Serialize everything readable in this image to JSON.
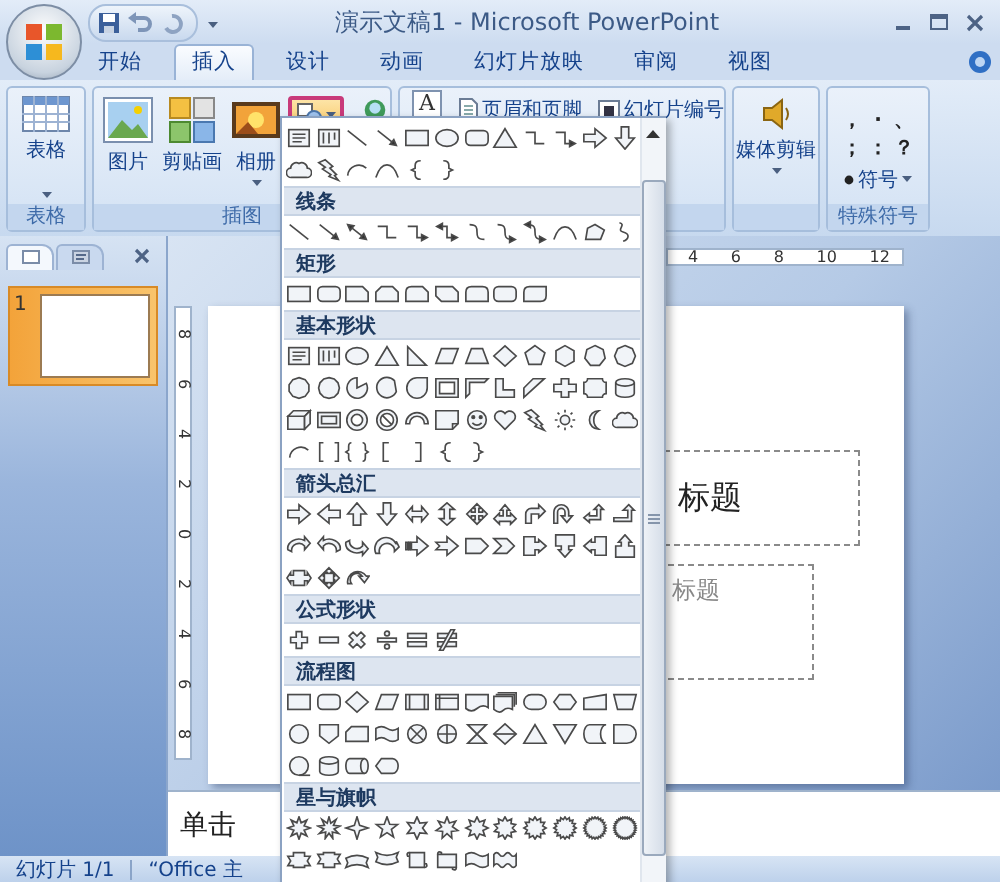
{
  "window": {
    "title": "演示文稿1 - Microsoft PowerPoint"
  },
  "tabs": [
    {
      "label": "开始",
      "selected": false
    },
    {
      "label": "插入",
      "selected": true
    },
    {
      "label": "设计",
      "selected": false
    },
    {
      "label": "动画",
      "selected": false
    },
    {
      "label": "幻灯片放映",
      "selected": false
    },
    {
      "label": "审阅",
      "selected": false
    },
    {
      "label": "视图",
      "selected": false
    }
  ],
  "ribbon": {
    "table_group": {
      "button": "表格",
      "label": "表格"
    },
    "illustrations_group": {
      "label": "插图",
      "buttons": [
        {
          "label": "图片",
          "kind": "picture",
          "has_menu": false
        },
        {
          "label": "剪贴画",
          "kind": "clipart",
          "has_menu": false
        },
        {
          "label": "相册",
          "kind": "album",
          "has_menu": true
        }
      ],
      "shapes_button": {
        "selected": true
      }
    },
    "text_group": {
      "textbox_glyph": "A",
      "buttons": [
        {
          "label": "页眉和页脚",
          "kind": "header"
        },
        {
          "label": "幻灯片编号",
          "kind": "number"
        }
      ]
    },
    "media_group": {
      "button": "媒体剪辑"
    },
    "symbols_group": {
      "marks": [
        "，",
        "·",
        "、",
        "；",
        "：",
        "？"
      ],
      "button": "符号",
      "label": "特殊符号"
    }
  },
  "shape_gallery": {
    "recent": [
      {
        "kind": "textbox"
      },
      {
        "kind": "vtextbox"
      },
      {
        "kind": "line"
      },
      {
        "kind": "arrow"
      },
      {
        "kind": "rect"
      },
      {
        "kind": "oval"
      },
      {
        "kind": "round-rect"
      },
      {
        "kind": "triangle"
      },
      {
        "kind": "elbow"
      },
      {
        "kind": "elbow-arrow"
      },
      {
        "kind": "right-arrow"
      },
      {
        "kind": "down-arrow"
      },
      {
        "kind": "cloud"
      },
      {
        "kind": "lightning"
      },
      {
        "kind": "arc"
      },
      {
        "kind": "curve"
      },
      {
        "kind": "brace-l"
      },
      {
        "kind": "brace-r"
      }
    ],
    "sections": [
      {
        "title": "线条",
        "shapes": [
          {
            "kind": "line"
          },
          {
            "kind": "arrow"
          },
          {
            "kind": "dbl-arrow"
          },
          {
            "kind": "elbow"
          },
          {
            "kind": "elbow-arrow"
          },
          {
            "kind": "elbow-dbl"
          },
          {
            "kind": "curve-s"
          },
          {
            "kind": "curve-arrow"
          },
          {
            "kind": "curve-dbl"
          },
          {
            "kind": "curve"
          },
          {
            "kind": "freeform"
          },
          {
            "kind": "scribble"
          }
        ]
      },
      {
        "title": "矩形",
        "shapes": [
          {
            "kind": "rect"
          },
          {
            "kind": "round-rect"
          },
          {
            "kind": "snip-rect"
          },
          {
            "kind": "snip-top"
          },
          {
            "kind": "round-snip"
          },
          {
            "kind": "snip-diag"
          },
          {
            "kind": "round-top"
          },
          {
            "kind": "round-rect"
          },
          {
            "kind": "round-diag"
          }
        ]
      },
      {
        "title": "基本形状",
        "shapes": [
          {
            "kind": "textbox"
          },
          {
            "kind": "vtextbox"
          },
          {
            "kind": "oval"
          },
          {
            "kind": "triangle"
          },
          {
            "kind": "rtriangle"
          },
          {
            "kind": "parallelogram"
          },
          {
            "kind": "trapezoid"
          },
          {
            "kind": "diamond"
          },
          {
            "kind": "pentagon"
          },
          {
            "kind": "hexagon"
          },
          {
            "kind": "heptagon"
          },
          {
            "kind": "octagon"
          },
          {
            "kind": "decagon"
          },
          {
            "kind": "dodecagon"
          },
          {
            "kind": "pie"
          },
          {
            "kind": "chord"
          },
          {
            "kind": "teardrop"
          },
          {
            "kind": "frame"
          },
          {
            "kind": "half-frame"
          },
          {
            "kind": "l-shape"
          },
          {
            "kind": "diag-stripe"
          },
          {
            "kind": "cross"
          },
          {
            "kind": "plaque"
          },
          {
            "kind": "can"
          },
          {
            "kind": "cube"
          },
          {
            "kind": "bevel"
          },
          {
            "kind": "donut"
          },
          {
            "kind": "no-symbol"
          },
          {
            "kind": "block-arc"
          },
          {
            "kind": "folded"
          },
          {
            "kind": "smiley"
          },
          {
            "kind": "heart"
          },
          {
            "kind": "lightning"
          },
          {
            "kind": "sun"
          },
          {
            "kind": "moon"
          },
          {
            "kind": "cloud"
          },
          {
            "kind": "arc"
          },
          {
            "kind": "bracket-pair"
          },
          {
            "kind": "brace-pair"
          },
          {
            "kind": "bracket-l"
          },
          {
            "kind": "bracket-r"
          },
          {
            "kind": "brace-l"
          },
          {
            "kind": "brace-r"
          }
        ]
      },
      {
        "title": "箭头总汇",
        "shapes": [
          {
            "kind": "right-arrow"
          },
          {
            "kind": "left-arrow"
          },
          {
            "kind": "up-arrow"
          },
          {
            "kind": "down-arrow"
          },
          {
            "kind": "lr-arrow"
          },
          {
            "kind": "ud-arrow"
          },
          {
            "kind": "quad-arrow"
          },
          {
            "kind": "lru-arrow"
          },
          {
            "kind": "bent-arrow"
          },
          {
            "kind": "uturn-arrow"
          },
          {
            "kind": "lu-arrow"
          },
          {
            "kind": "bent-up-arrow"
          },
          {
            "kind": "curved-right"
          },
          {
            "kind": "curved-left"
          },
          {
            "kind": "curved-up"
          },
          {
            "kind": "curved-down"
          },
          {
            "kind": "striped-arrow"
          },
          {
            "kind": "notched-arrow"
          },
          {
            "kind": "pentagon-arrow"
          },
          {
            "kind": "chevron"
          },
          {
            "kind": "right-callout"
          },
          {
            "kind": "down-callout"
          },
          {
            "kind": "left-callout"
          },
          {
            "kind": "up-callout"
          },
          {
            "kind": "lr-callout"
          },
          {
            "kind": "quad-callout"
          },
          {
            "kind": "circular-arrow"
          }
        ]
      },
      {
        "title": "公式形状",
        "shapes": [
          {
            "kind": "eq-plus"
          },
          {
            "kind": "eq-minus"
          },
          {
            "kind": "eq-times"
          },
          {
            "kind": "eq-divide"
          },
          {
            "kind": "eq-equal"
          },
          {
            "kind": "eq-not-equal"
          }
        ]
      },
      {
        "title": "流程图",
        "shapes": [
          {
            "kind": "rect"
          },
          {
            "kind": "round-rect"
          },
          {
            "kind": "diamond"
          },
          {
            "kind": "parallelogram"
          },
          {
            "kind": "predefined"
          },
          {
            "kind": "internal"
          },
          {
            "kind": "document"
          },
          {
            "kind": "multidoc"
          },
          {
            "kind": "terminator"
          },
          {
            "kind": "preparation"
          },
          {
            "kind": "manual-input"
          },
          {
            "kind": "manual-op"
          },
          {
            "kind": "circle"
          },
          {
            "kind": "offpage"
          },
          {
            "kind": "card"
          },
          {
            "kind": "punched-tape"
          },
          {
            "kind": "summing"
          },
          {
            "kind": "or"
          },
          {
            "kind": "collate"
          },
          {
            "kind": "sort"
          },
          {
            "kind": "triangle"
          },
          {
            "kind": "merge"
          },
          {
            "kind": "stored-data"
          },
          {
            "kind": "delay"
          },
          {
            "kind": "seq-access"
          },
          {
            "kind": "can"
          },
          {
            "kind": "drum"
          },
          {
            "kind": "display"
          }
        ]
      },
      {
        "title": "星与旗帜",
        "shapes": [
          {
            "kind": "explosion1"
          },
          {
            "kind": "explosion2"
          },
          {
            "kind": "star4"
          },
          {
            "kind": "star5"
          },
          {
            "kind": "star6"
          },
          {
            "kind": "star7"
          },
          {
            "kind": "star8"
          },
          {
            "kind": "star10"
          },
          {
            "kind": "star12"
          },
          {
            "kind": "star16"
          },
          {
            "kind": "star24"
          },
          {
            "kind": "star32"
          },
          {
            "kind": "ribbon-up"
          },
          {
            "kind": "ribbon-down"
          },
          {
            "kind": "curved-ribbon-up"
          },
          {
            "kind": "curved-ribbon-down"
          },
          {
            "kind": "scroll-v"
          },
          {
            "kind": "scroll-h"
          },
          {
            "kind": "wave"
          },
          {
            "kind": "double-wave"
          }
        ]
      }
    ]
  },
  "slide_pane": {
    "tabs": [
      {
        "kind": "slides",
        "selected": true
      },
      {
        "kind": "outline",
        "selected": false
      }
    ],
    "slides": [
      {
        "number": "1",
        "selected": true
      }
    ]
  },
  "rulers": {
    "horizontal": [
      "4",
      "6",
      "8",
      "10",
      "12"
    ],
    "vertical": [
      "8",
      "6",
      "4",
      "2",
      "0",
      "2",
      "4",
      "6",
      "8"
    ]
  },
  "slide": {
    "title_text": "标题",
    "subtitle_text": "标题"
  },
  "notes": {
    "text": "单击"
  },
  "status_bar": {
    "slide": "幻灯片 1/1",
    "theme": "“Office 主"
  }
}
